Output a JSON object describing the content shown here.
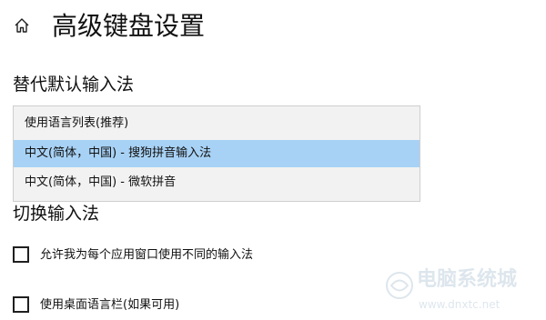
{
  "header": {
    "title": "高级键盘设置",
    "home_icon": "home-icon"
  },
  "default_input_method": {
    "heading": "替代默认输入法",
    "options": [
      {
        "label": "使用语言列表(推荐)",
        "selected": false
      },
      {
        "label": "中文(简体，中国) - 搜狗拼音输入法",
        "selected": true
      },
      {
        "label": "中文(简体，中国) - 微软拼音",
        "selected": false
      }
    ],
    "highlight_color": "#a8d2f5"
  },
  "switch_input": {
    "heading": "切换输入法",
    "per_app_window": {
      "label": "允许我为每个应用窗口使用不同的输入法",
      "checked": false
    },
    "desktop_language_bar": {
      "label": "使用桌面语言栏(如果可用)",
      "checked": false
    }
  },
  "watermark": {
    "line1": "电脑系统城",
    "line2": "www.dnxtc.net"
  }
}
